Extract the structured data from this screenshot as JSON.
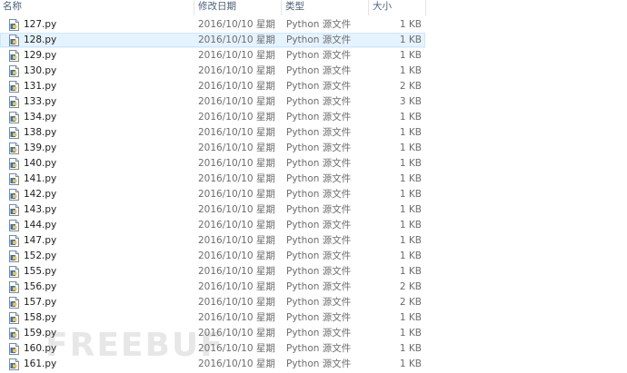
{
  "columns": {
    "name": "名称",
    "date": "修改日期",
    "type": "类型",
    "size": "大小"
  },
  "files": [
    {
      "name": "127.py",
      "date": "2016/10/10 星期...",
      "type": "Python 源文件",
      "size": "1 KB",
      "selected": false
    },
    {
      "name": "128.py",
      "date": "2016/10/10 星期...",
      "type": "Python 源文件",
      "size": "1 KB",
      "selected": true
    },
    {
      "name": "129.py",
      "date": "2016/10/10 星期...",
      "type": "Python 源文件",
      "size": "1 KB",
      "selected": false
    },
    {
      "name": "130.py",
      "date": "2016/10/10 星期...",
      "type": "Python 源文件",
      "size": "1 KB",
      "selected": false
    },
    {
      "name": "131.py",
      "date": "2016/10/10 星期...",
      "type": "Python 源文件",
      "size": "2 KB",
      "selected": false
    },
    {
      "name": "133.py",
      "date": "2016/10/10 星期...",
      "type": "Python 源文件",
      "size": "3 KB",
      "selected": false
    },
    {
      "name": "134.py",
      "date": "2016/10/10 星期...",
      "type": "Python 源文件",
      "size": "1 KB",
      "selected": false
    },
    {
      "name": "138.py",
      "date": "2016/10/10 星期...",
      "type": "Python 源文件",
      "size": "1 KB",
      "selected": false
    },
    {
      "name": "139.py",
      "date": "2016/10/10 星期...",
      "type": "Python 源文件",
      "size": "1 KB",
      "selected": false
    },
    {
      "name": "140.py",
      "date": "2016/10/10 星期...",
      "type": "Python 源文件",
      "size": "1 KB",
      "selected": false
    },
    {
      "name": "141.py",
      "date": "2016/10/10 星期...",
      "type": "Python 源文件",
      "size": "1 KB",
      "selected": false
    },
    {
      "name": "142.py",
      "date": "2016/10/10 星期...",
      "type": "Python 源文件",
      "size": "1 KB",
      "selected": false
    },
    {
      "name": "143.py",
      "date": "2016/10/10 星期...",
      "type": "Python 源文件",
      "size": "1 KB",
      "selected": false
    },
    {
      "name": "144.py",
      "date": "2016/10/10 星期...",
      "type": "Python 源文件",
      "size": "1 KB",
      "selected": false
    },
    {
      "name": "147.py",
      "date": "2016/10/10 星期...",
      "type": "Python 源文件",
      "size": "1 KB",
      "selected": false
    },
    {
      "name": "152.py",
      "date": "2016/10/10 星期...",
      "type": "Python 源文件",
      "size": "1 KB",
      "selected": false
    },
    {
      "name": "155.py",
      "date": "2016/10/10 星期...",
      "type": "Python 源文件",
      "size": "1 KB",
      "selected": false
    },
    {
      "name": "156.py",
      "date": "2016/10/10 星期...",
      "type": "Python 源文件",
      "size": "2 KB",
      "selected": false
    },
    {
      "name": "157.py",
      "date": "2016/10/10 星期...",
      "type": "Python 源文件",
      "size": "2 KB",
      "selected": false
    },
    {
      "name": "158.py",
      "date": "2016/10/10 星期...",
      "type": "Python 源文件",
      "size": "1 KB",
      "selected": false
    },
    {
      "name": "159.py",
      "date": "2016/10/10 星期...",
      "type": "Python 源文件",
      "size": "1 KB",
      "selected": false
    },
    {
      "name": "160.py",
      "date": "2016/10/10 星期...",
      "type": "Python 源文件",
      "size": "1 KB",
      "selected": false
    },
    {
      "name": "161.py",
      "date": "2016/10/10 星期...",
      "type": "Python 源文件",
      "size": "1 KB",
      "selected": false
    }
  ],
  "icon": "python-file-icon",
  "watermark": "FREEBUF",
  "colors": {
    "selection_bg": "#e5f3ff",
    "selection_border": "#cce8ff",
    "header_text": "#4c607a",
    "secondary_text": "#6d6d6d"
  }
}
